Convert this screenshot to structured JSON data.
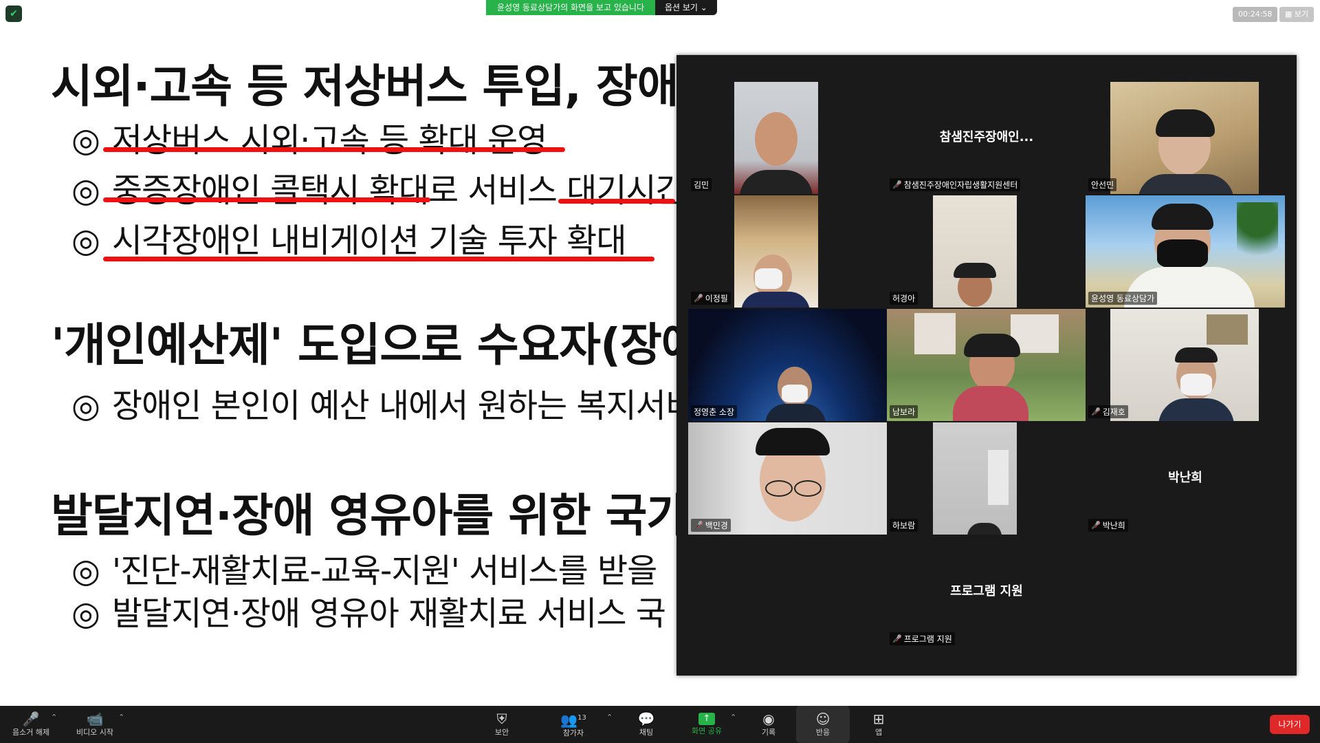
{
  "share_banner": {
    "text": "윤성영 동료상담가의 화면을 보고 있습니다",
    "options_label": "옵션 보기 ⌄"
  },
  "timer": "00:24:58",
  "view_button": "▦ 보기",
  "slide": {
    "heading1": "시외·고속 등 저상버스 투입, 장애",
    "bullet_marker": "◎",
    "bullets1": [
      "저상버스 시외·고속 등 확대 운영",
      "중증장애인 콜택시 확대로 서비스 대기시간",
      "시각장애인 내비게이션 기술 투자 확대"
    ],
    "heading2": "'개인예산제' 도입으로 수요자(장애",
    "bullets2": [
      "장애인 본인이 예산 내에서 원하는 복지서비"
    ],
    "heading3": "발달지연·장애 영유아를 위한 국가",
    "bullets3": [
      "'진단-재활치료-교육-지원' 서비스를 받을",
      "발달지연·장애 영유아 재활치료 서비스 국"
    ]
  },
  "participants": [
    {
      "name": "김민",
      "muted": false,
      "video": true
    },
    {
      "name": "참샘진주장애인자립생활지원센터",
      "display": "참샘진주장애인...",
      "muted": true,
      "video": false
    },
    {
      "name": "안선민",
      "muted": false,
      "video": true
    },
    {
      "name": "이정필",
      "muted": true,
      "video": true
    },
    {
      "name": "허경아",
      "muted": false,
      "video": true
    },
    {
      "name": "윤성영 동료상담가",
      "muted": false,
      "video": true
    },
    {
      "name": "정영춘 소장",
      "muted": false,
      "video": true
    },
    {
      "name": "남보라",
      "muted": false,
      "video": true,
      "active": true
    },
    {
      "name": "김재호",
      "muted": true,
      "video": true
    },
    {
      "name": "백민경",
      "muted": true,
      "video": true
    },
    {
      "name": "하보람",
      "muted": false,
      "video": true
    },
    {
      "name": "박난희",
      "display": "박난희",
      "muted": true,
      "video": false
    },
    {
      "name": "프로그램 지원",
      "display": "프로그램 지원",
      "muted": true,
      "video": false
    }
  ],
  "toolbar": {
    "unmute": "음소거 해제",
    "start_video": "비디오 시작",
    "security": "보안",
    "participants": "참가자",
    "participants_count": "13",
    "chat": "채팅",
    "share_screen": "화면 공유",
    "record": "기록",
    "reactions": "반응",
    "apps": "앱",
    "leave": "나가기"
  },
  "colors": {
    "accent_green": "#27b24a",
    "leave_red": "#e02828",
    "underline_red": "#e11111",
    "active_speaker": "#c8d600"
  }
}
